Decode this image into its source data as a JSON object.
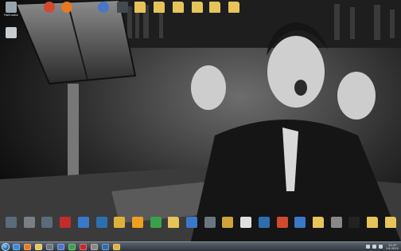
{
  "desktop": {
    "top_icons": [
      {
        "label": "Računalo",
        "icon": "computer-icon",
        "color": "#9aa4ad"
      },
      {
        "label": "",
        "icon": "browser-icon",
        "color": "#d04a2f"
      },
      {
        "label": "",
        "icon": "firefox-icon",
        "color": "#e47a23"
      },
      {
        "label": "",
        "icon": "web-icon",
        "color": "#4a76c6"
      },
      {
        "label": "",
        "icon": "app-icon",
        "color": "#444a52"
      },
      {
        "label": "",
        "icon": "folder-icon",
        "color": "#e6c45a"
      },
      {
        "label": "",
        "icon": "folder-icon",
        "color": "#e6c45a"
      },
      {
        "label": "",
        "icon": "folder-icon",
        "color": "#e6c45a"
      },
      {
        "label": "",
        "icon": "folder-icon",
        "color": "#e6c45a"
      },
      {
        "label": "",
        "icon": "folder-icon",
        "color": "#e6c45a"
      },
      {
        "label": "",
        "icon": "folder-icon",
        "color": "#e6c45a"
      }
    ],
    "second_row_icons": [
      {
        "label": "",
        "icon": "recycle-bin-icon",
        "color": "#c8cdd2"
      }
    ],
    "bottom_icons": [
      {
        "label": "",
        "icon": "app-icon",
        "color": "#5b6b7a"
      },
      {
        "label": "",
        "icon": "app-icon",
        "color": "#7a7f86"
      },
      {
        "label": "",
        "icon": "app-icon",
        "color": "#5b6b7a"
      },
      {
        "label": "",
        "icon": "app-icon",
        "color": "#c12c2c"
      },
      {
        "label": "",
        "icon": "app-icon",
        "color": "#3a78c8"
      },
      {
        "label": "",
        "icon": "app-icon",
        "color": "#2c6fb0"
      },
      {
        "label": "",
        "icon": "app-icon",
        "color": "#e0b13a"
      },
      {
        "label": "",
        "icon": "app-icon",
        "color": "#f0a020"
      },
      {
        "label": "",
        "icon": "app-icon",
        "color": "#3ba04a"
      },
      {
        "label": "",
        "icon": "folder-icon",
        "color": "#e6c45a"
      },
      {
        "label": "",
        "icon": "app-icon",
        "color": "#3a78c8"
      },
      {
        "label": "",
        "icon": "app-icon",
        "color": "#6a7580"
      },
      {
        "label": "",
        "icon": "app-icon",
        "color": "#cfa23a"
      },
      {
        "label": "",
        "icon": "app-icon",
        "color": "#e0e0e0"
      },
      {
        "label": "",
        "icon": "app-icon",
        "color": "#2c6fb0"
      },
      {
        "label": "",
        "icon": "app-icon",
        "color": "#d04a2f"
      },
      {
        "label": "",
        "icon": "app-icon",
        "color": "#3a78c8"
      },
      {
        "label": "",
        "icon": "folder-icon",
        "color": "#e6c45a"
      },
      {
        "label": "",
        "icon": "app-icon",
        "color": "#888"
      },
      {
        "label": "",
        "icon": "app-icon",
        "color": "#222"
      },
      {
        "label": "",
        "icon": "folder-icon",
        "color": "#e6c45a"
      },
      {
        "label": "",
        "icon": "folder-icon",
        "color": "#e6c45a"
      }
    ]
  },
  "taskbar": {
    "items": [
      {
        "icon": "ie-icon",
        "color": "#3a8ad8"
      },
      {
        "icon": "firefox-icon",
        "color": "#e47a23"
      },
      {
        "icon": "explorer-icon",
        "color": "#e6c45a"
      },
      {
        "icon": "app-icon",
        "color": "#6a7580"
      },
      {
        "icon": "app-icon",
        "color": "#4a76c6"
      },
      {
        "icon": "app-icon",
        "color": "#3ba04a"
      },
      {
        "icon": "app-icon",
        "color": "#c12c2c"
      },
      {
        "icon": "app-icon",
        "color": "#888"
      },
      {
        "icon": "app-icon",
        "color": "#2c6fb0"
      },
      {
        "icon": "app-icon",
        "color": "#e0b13a"
      }
    ],
    "clock": {
      "time": "21:27",
      "date": "1.6.2012."
    }
  }
}
